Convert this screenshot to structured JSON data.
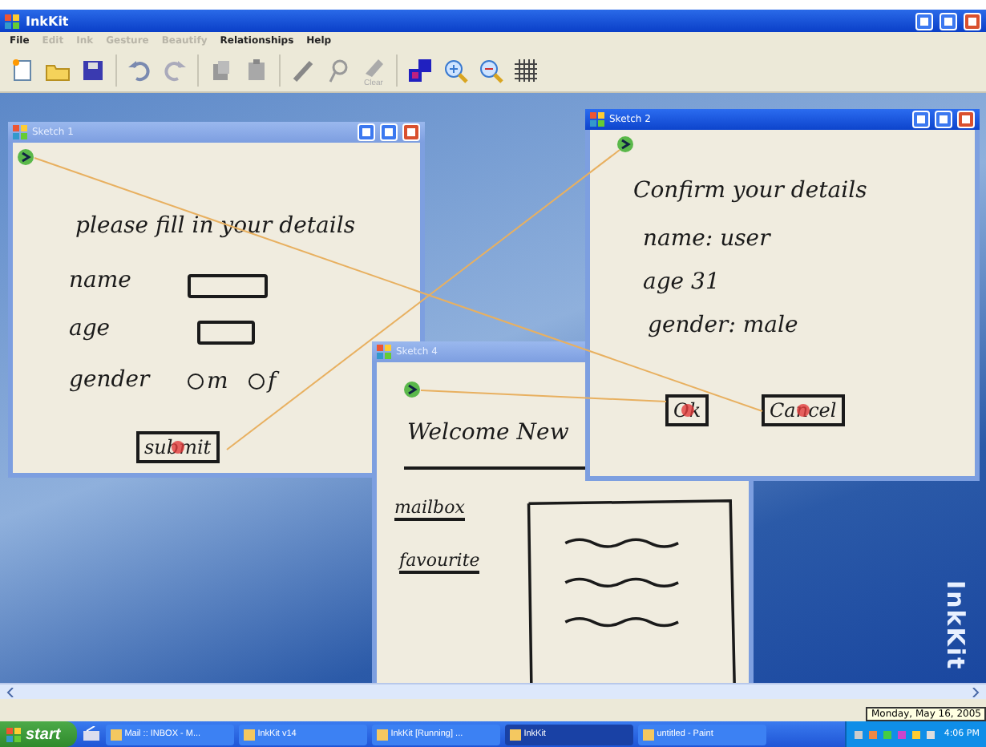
{
  "app": {
    "title": "InkKit"
  },
  "menu": [
    {
      "label": "File",
      "disabled": false
    },
    {
      "label": "Edit",
      "disabled": true
    },
    {
      "label": "Ink",
      "disabled": true
    },
    {
      "label": "Gesture",
      "disabled": true
    },
    {
      "label": "Beautify",
      "disabled": true
    },
    {
      "label": "Relationships",
      "disabled": false
    },
    {
      "label": "Help",
      "disabled": false
    }
  ],
  "toolbar": {
    "clear_label": "Clear"
  },
  "sketches": [
    {
      "title": "Sketch 1",
      "active": false,
      "heading": "please fill in your details",
      "fields": [
        {
          "label": "name"
        },
        {
          "label": "age"
        }
      ],
      "gender": {
        "label": "gender",
        "options": [
          {
            "label": "m",
            "selected": false
          },
          {
            "label": "f",
            "selected": false
          }
        ]
      },
      "button": "submit"
    },
    {
      "title": "Sketch 4",
      "active": false,
      "heading": "Welcome New",
      "links": [
        "mailbox",
        "favourite"
      ]
    },
    {
      "title": "Sketch 2",
      "active": true,
      "heading": "Confirm your details",
      "lines": [
        "name: user",
        "age  31",
        "gender: male"
      ],
      "buttons": [
        "Ok",
        "Cancel"
      ]
    }
  ],
  "logo": "InkKit",
  "clock_tooltip": "Monday, May 16, 2005",
  "taskbar": {
    "start": "start",
    "tasks": [
      {
        "label": "Mail :: INBOX - M...",
        "selected": false
      },
      {
        "label": "InkKit v14",
        "selected": false
      },
      {
        "label": "InkKit [Running] ...",
        "selected": false
      },
      {
        "label": "InkKit",
        "selected": true
      },
      {
        "label": "untitled - Paint",
        "selected": false
      }
    ],
    "time": "4:06 PM"
  }
}
